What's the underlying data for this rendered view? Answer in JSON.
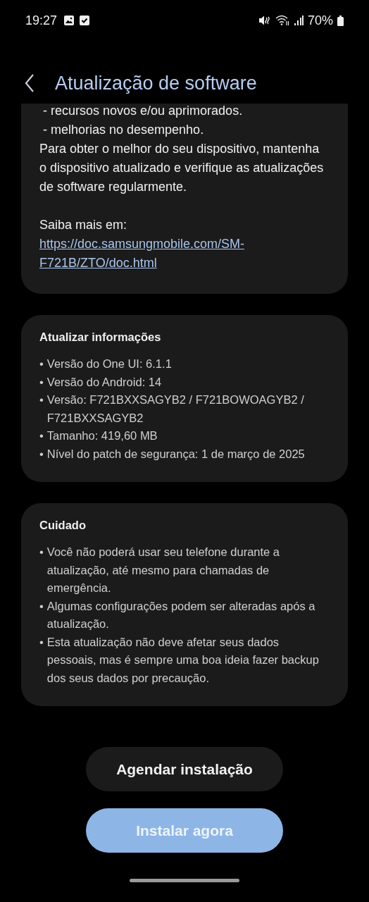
{
  "status_bar": {
    "time": "19:27",
    "battery": "70%"
  },
  "header": {
    "title": "Atualização de software"
  },
  "notes": {
    "lines": [
      "- recursos novos e/ou aprimorados.",
      "- melhorias no desempenho."
    ],
    "paragraph": "Para obter o melhor do seu dispositivo, mantenha o dispositivo atualizado e verifique as atualizações de software regularmente.",
    "more_label": "Saiba mais em:",
    "link": "https://doc.samsungmobile.com/SM-F721B/ZTO/doc.html"
  },
  "info": {
    "title": "Atualizar informações",
    "items": [
      {
        "bullet": "•",
        "text": "Versão do One UI: 6.1.1"
      },
      {
        "bullet": "•",
        "text": "Versão do Android: 14"
      },
      {
        "bullet": "•",
        "text": "Versão: F721BXXSAGYB2 / F721BOWOAGYB2 / F721BXXSAGYB2"
      },
      {
        "bullet": "•",
        "text": "Tamanho: 419,60 MB"
      },
      {
        "bullet": "•",
        "text": "Nível do patch de segurança: 1 de março de 2025"
      }
    ]
  },
  "caution": {
    "title": "Cuidado",
    "items": [
      {
        "bullet": "•",
        "text": "Você não poderá usar seu telefone durante a atualização, até mesmo para chamadas de emergência."
      },
      {
        "bullet": "•",
        "text": "Algumas configurações podem ser alteradas após a atualização."
      },
      {
        "bullet": "•",
        "text": "Esta atualização não deve afetar seus dados pessoais, mas é sempre uma boa ideia fazer backup dos seus dados por precaução."
      }
    ]
  },
  "buttons": [
    {
      "label": "Agendar instalação",
      "kind": "secondary"
    },
    {
      "label": "Instalar agora",
      "kind": "primary"
    }
  ]
}
